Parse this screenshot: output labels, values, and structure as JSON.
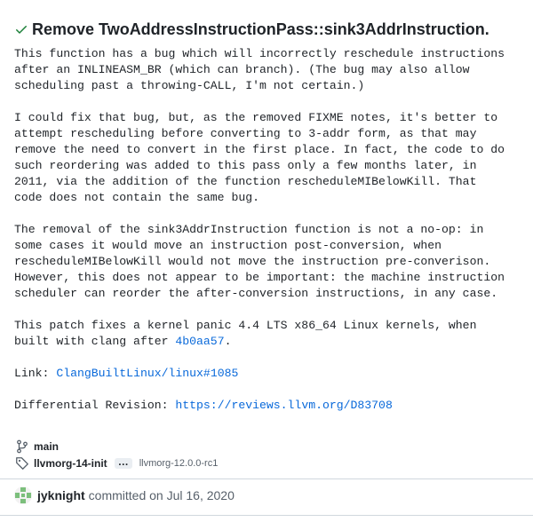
{
  "commit": {
    "title": "Remove TwoAddressInstructionPass::sink3AddrInstruction.",
    "status_icon": "check-icon",
    "status_color": "#1a7f37",
    "message": {
      "p1": "This function has a bug which will incorrectly reschedule instructions\nafter an INLINEASM_BR (which can branch). (The bug may also allow\nscheduling past a throwing-CALL, I'm not certain.)",
      "p2": "I could fix that bug, but, as the removed FIXME notes, it's better to\nattempt rescheduling before converting to 3-addr form, as that may\nremove the need to convert in the first place. In fact, the code to do\nsuch reordering was added to this pass only a few months later, in\n2011, via the addition of the function rescheduleMIBelowKill. That\ncode does not contain the same bug.",
      "p3": "The removal of the sink3AddrInstruction function is not a no-op: in\nsome cases it would move an instruction post-conversion, when\nrescheduleMIBelowKill would not move the instruction pre-converison.\nHowever, this does not appear to be important: the machine instruction\nscheduler can reorder the after-conversion instructions, in any case.",
      "p4_prefix": "This patch fixes a kernel panic 4.4 LTS x86_64 Linux kernels, when\nbuilt with clang after ",
      "p4_link": "4b0aa57",
      "p4_suffix": ".",
      "link_label": "Link: ",
      "link_text": "ClangBuiltLinux/linux#1085",
      "diff_label": "Differential Revision: ",
      "diff_link": "https://reviews.llvm.org/D83708"
    },
    "branch": {
      "icon": "git-branch-icon",
      "name": "main"
    },
    "tags": {
      "icon": "tag-icon",
      "primary": "llvmorg-14-init",
      "more_label": "…",
      "secondary": "llvmorg-12.0.0-rc1"
    },
    "author": {
      "avatar": "identicon-avatar",
      "name": "jyknight",
      "committed_text": "committed on Jul 16, 2020"
    }
  }
}
